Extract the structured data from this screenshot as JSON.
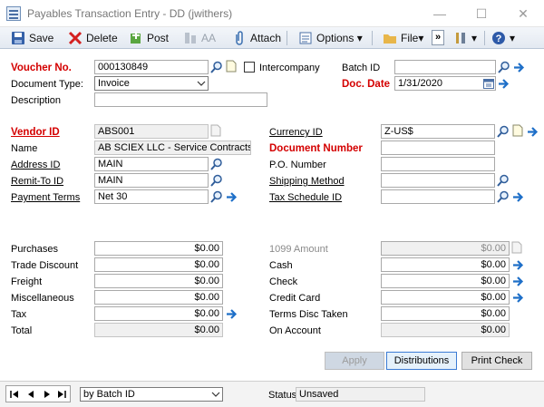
{
  "window": {
    "title": "Payables Transaction Entry  -  DD (jwithers)"
  },
  "toolbar": {
    "save": "Save",
    "delete": "Delete",
    "post": "Post",
    "aa": "AA",
    "attach": "Attach",
    "options": "Options",
    "file": "File",
    "more": "»"
  },
  "header": {
    "voucher_label": "Voucher No.",
    "voucher_value": "000130849",
    "intercompany_label": "Intercompany",
    "batch_label": "Batch ID",
    "batch_value": "",
    "doctype_label": "Document Type:",
    "doctype_value": "Invoice",
    "docdate_label": "Doc. Date",
    "docdate_value": "1/31/2020",
    "description_label": "Description",
    "description_value": ""
  },
  "vendor": {
    "vendor_id_label": "Vendor ID",
    "vendor_id_value": "ABS001",
    "name_label": "Name",
    "name_value": "AB SCIEX LLC - Service Contracts",
    "address_label": "Address ID",
    "address_value": "MAIN",
    "remit_label": "Remit-To ID",
    "remit_value": "MAIN",
    "terms_label": "Payment Terms",
    "terms_value": "Net 30",
    "currency_label": "Currency ID",
    "currency_value": "Z-US$",
    "docnum_label": "Document Number",
    "docnum_value": "",
    "po_label": "P.O. Number",
    "po_value": "",
    "shipping_label": "Shipping Method",
    "shipping_value": "",
    "taxsched_label": "Tax Schedule ID",
    "taxsched_value": ""
  },
  "amounts_left": [
    {
      "label": "Purchases",
      "value": "$0.00"
    },
    {
      "label": "Trade Discount",
      "value": "$0.00"
    },
    {
      "label": "Freight",
      "value": "$0.00"
    },
    {
      "label": "Miscellaneous",
      "value": "$0.00"
    },
    {
      "label": "Tax",
      "value": "$0.00"
    },
    {
      "label": "Total",
      "value": "$0.00"
    }
  ],
  "amounts_right": [
    {
      "label": "1099 Amount",
      "value": "$0.00"
    },
    {
      "label": "Cash",
      "value": "$0.00"
    },
    {
      "label": "Check",
      "value": "$0.00"
    },
    {
      "label": "Credit Card",
      "value": "$0.00"
    },
    {
      "label": "Terms Disc Taken",
      "value": "$0.00"
    },
    {
      "label": "On Account",
      "value": "$0.00"
    }
  ],
  "buttons": {
    "apply": "Apply",
    "distributions": "Distributions",
    "print_check": "Print Check"
  },
  "footer": {
    "sort_value": "by Batch ID",
    "status_label": "Status",
    "status_value": "Unsaved"
  },
  "colors": {
    "required_label": "#d40000",
    "arrow_blue": "#1e6fc8"
  }
}
